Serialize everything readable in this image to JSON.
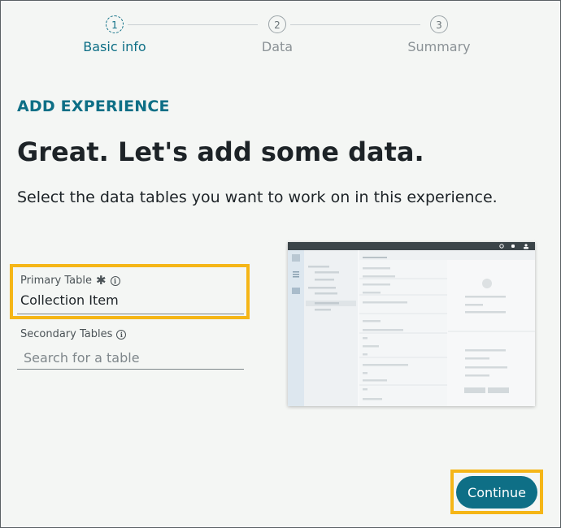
{
  "stepper": {
    "steps": [
      {
        "number": "1",
        "label": "Basic info",
        "state": "active"
      },
      {
        "number": "2",
        "label": "Data",
        "state": "inactive"
      },
      {
        "number": "3",
        "label": "Summary",
        "state": "inactive"
      }
    ]
  },
  "page": {
    "eyebrow": "ADD EXPERIENCE",
    "headline": "Great. Let's add some data.",
    "description": "Select the data tables you want to work on in this experience."
  },
  "primary_table": {
    "label": "Primary Table",
    "required_mark": "✱",
    "value": "Collection Item"
  },
  "secondary_tables": {
    "label": "Secondary Tables",
    "placeholder": "Search for a table",
    "value": ""
  },
  "footer": {
    "continue_label": "Continue"
  },
  "colors": {
    "accent": "#0e6f86",
    "highlight": "#f5b617",
    "background": "#f4f6f4"
  }
}
